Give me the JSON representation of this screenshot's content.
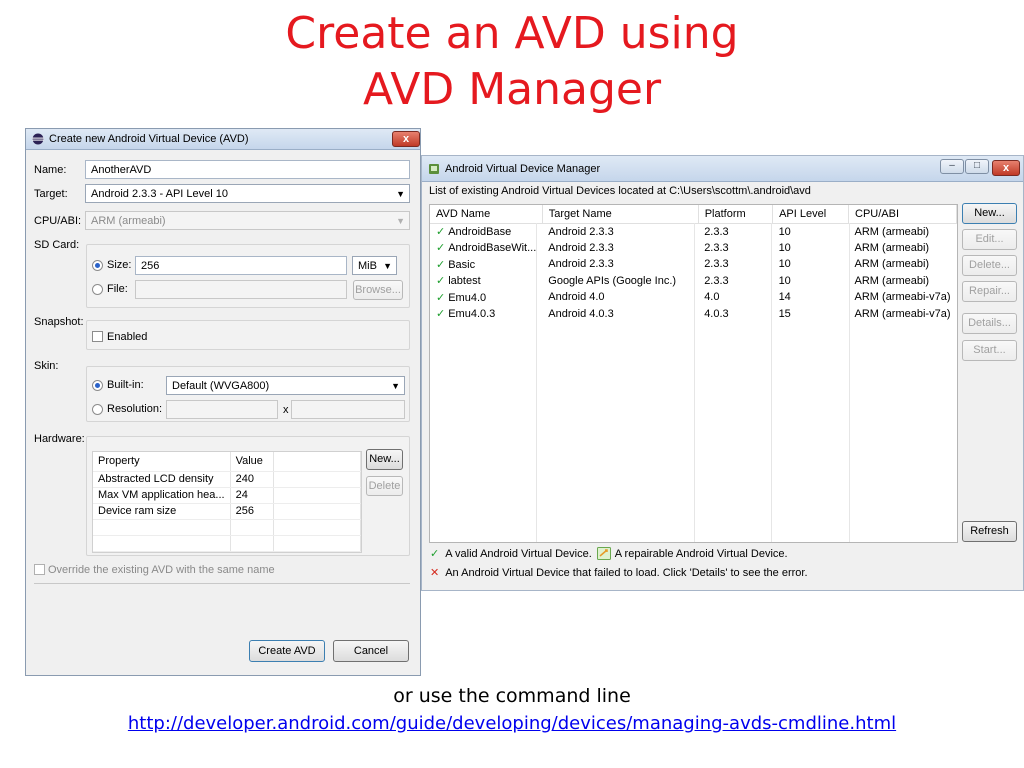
{
  "slide": {
    "title_line1": "Create an AVD using",
    "title_line2": "AVD Manager",
    "caption": "or use the command line",
    "link": "http://developer.android.com/guide/developing/devices/managing-avds-cmdline.html"
  },
  "create_dialog": {
    "title": "Create new Android Virtual Device (AVD)",
    "close_label": "x",
    "name_label": "Name:",
    "name_value": "AnotherAVD",
    "target_label": "Target:",
    "target_value": "Android 2.3.3 - API Level 10",
    "cpu_label": "CPU/ABI:",
    "cpu_value": "ARM (armeabi)",
    "sdcard_label": "SD Card:",
    "size_label": "Size:",
    "size_value": "256",
    "size_unit": "MiB",
    "file_label": "File:",
    "browse_label": "Browse...",
    "snapshot_label": "Snapshot:",
    "enabled_label": "Enabled",
    "skin_label": "Skin:",
    "builtin_label": "Built-in:",
    "builtin_value": "Default (WVGA800)",
    "resolution_label": "Resolution:",
    "resolution_x": "x",
    "hardware_label": "Hardware:",
    "hw_columns": [
      "Property",
      "Value"
    ],
    "hw_rows": [
      [
        "Abstracted LCD density",
        "240"
      ],
      [
        "Max VM application hea...",
        "24"
      ],
      [
        "Device ram size",
        "256"
      ]
    ],
    "hw_new_label": "New...",
    "hw_delete_label": "Delete",
    "override_label": "Override the existing AVD with the same name",
    "create_label": "Create AVD",
    "cancel_label": "Cancel"
  },
  "manager": {
    "title": "Android Virtual Device Manager",
    "list_caption": "List of existing Android Virtual Devices located at C:\\Users\\scottm\\.android\\avd",
    "columns": [
      "AVD Name",
      "Target Name",
      "Platform",
      "API Level",
      "CPU/ABI"
    ],
    "rows": [
      [
        "AndroidBase",
        "Android 2.3.3",
        "2.3.3",
        "10",
        "ARM (armeabi)"
      ],
      [
        "AndroidBaseWit...",
        "Android 2.3.3",
        "2.3.3",
        "10",
        "ARM (armeabi)"
      ],
      [
        "Basic",
        "Android 2.3.3",
        "2.3.3",
        "10",
        "ARM (armeabi)"
      ],
      [
        "labtest",
        "Google APIs (Google Inc.)",
        "2.3.3",
        "10",
        "ARM (armeabi)"
      ],
      [
        "Emu4.0",
        "Android 4.0",
        "4.0",
        "14",
        "ARM (armeabi-v7a)"
      ],
      [
        "Emu4.0.3",
        "Android 4.0.3",
        "4.0.3",
        "15",
        "ARM (armeabi-v7a)"
      ]
    ],
    "buttons": {
      "new": "New...",
      "edit": "Edit...",
      "delete": "Delete...",
      "repair": "Repair...",
      "details": "Details...",
      "start": "Start...",
      "refresh": "Refresh"
    },
    "legend_valid": "A valid Android Virtual Device.",
    "legend_repairable": "A repairable Android Virtual Device.",
    "legend_failed": "An Android Virtual Device that failed to load. Click 'Details' to see the error.",
    "min_label": "–",
    "max_label": "□",
    "close_label": "x"
  }
}
